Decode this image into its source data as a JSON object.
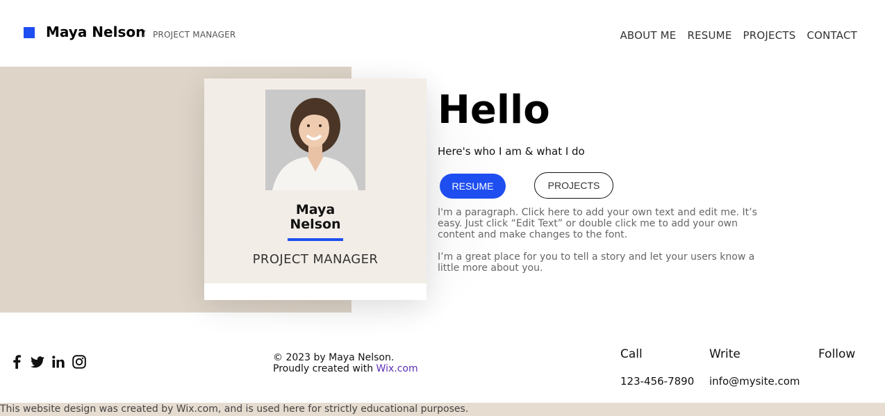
{
  "header": {
    "site_name": "Maya Nelson",
    "separator": "/",
    "site_role": "PROJECT MANAGER",
    "nav": [
      {
        "label": "ABOUT ME"
      },
      {
        "label": "RESUME"
      },
      {
        "label": "PROJECTS"
      },
      {
        "label": "CONTACT"
      }
    ]
  },
  "card": {
    "name_line1": "Maya",
    "name_line2": "Nelson",
    "role": "PROJECT MANAGER"
  },
  "hero": {
    "title": "Hello",
    "subtitle": "Here's who I am & what I do",
    "resume_button": "RESUME",
    "projects_button": "PROJECTS",
    "paragraph1": "I'm a paragraph. Click here to add your own text and edit me. It’s easy. Just click “Edit Text” or double click me to add your own content and make changes to the font.",
    "paragraph2": "I’m a great place for you to tell a story and let your users know a little more about you."
  },
  "footer": {
    "copyright": "© 2023 by Maya Nelson.",
    "created_prefix": "Proudly created with ",
    "created_link": "Wix.com",
    "call_label": "Call",
    "write_label": "Write",
    "follow_label": "Follow",
    "phone": "123-456-7890",
    "email": "info@mysite.com",
    "social_icons": [
      "facebook-icon",
      "twitter-icon",
      "linkedin-icon",
      "instagram-icon"
    ]
  },
  "disclaimer": "This website design was created by Wix.com, and is used here for strictly educational purposes.",
  "colors": {
    "accent": "#1e4ef0",
    "beige": "#ded4c8",
    "card": "#f3ede7",
    "link": "#5b2fb5"
  }
}
